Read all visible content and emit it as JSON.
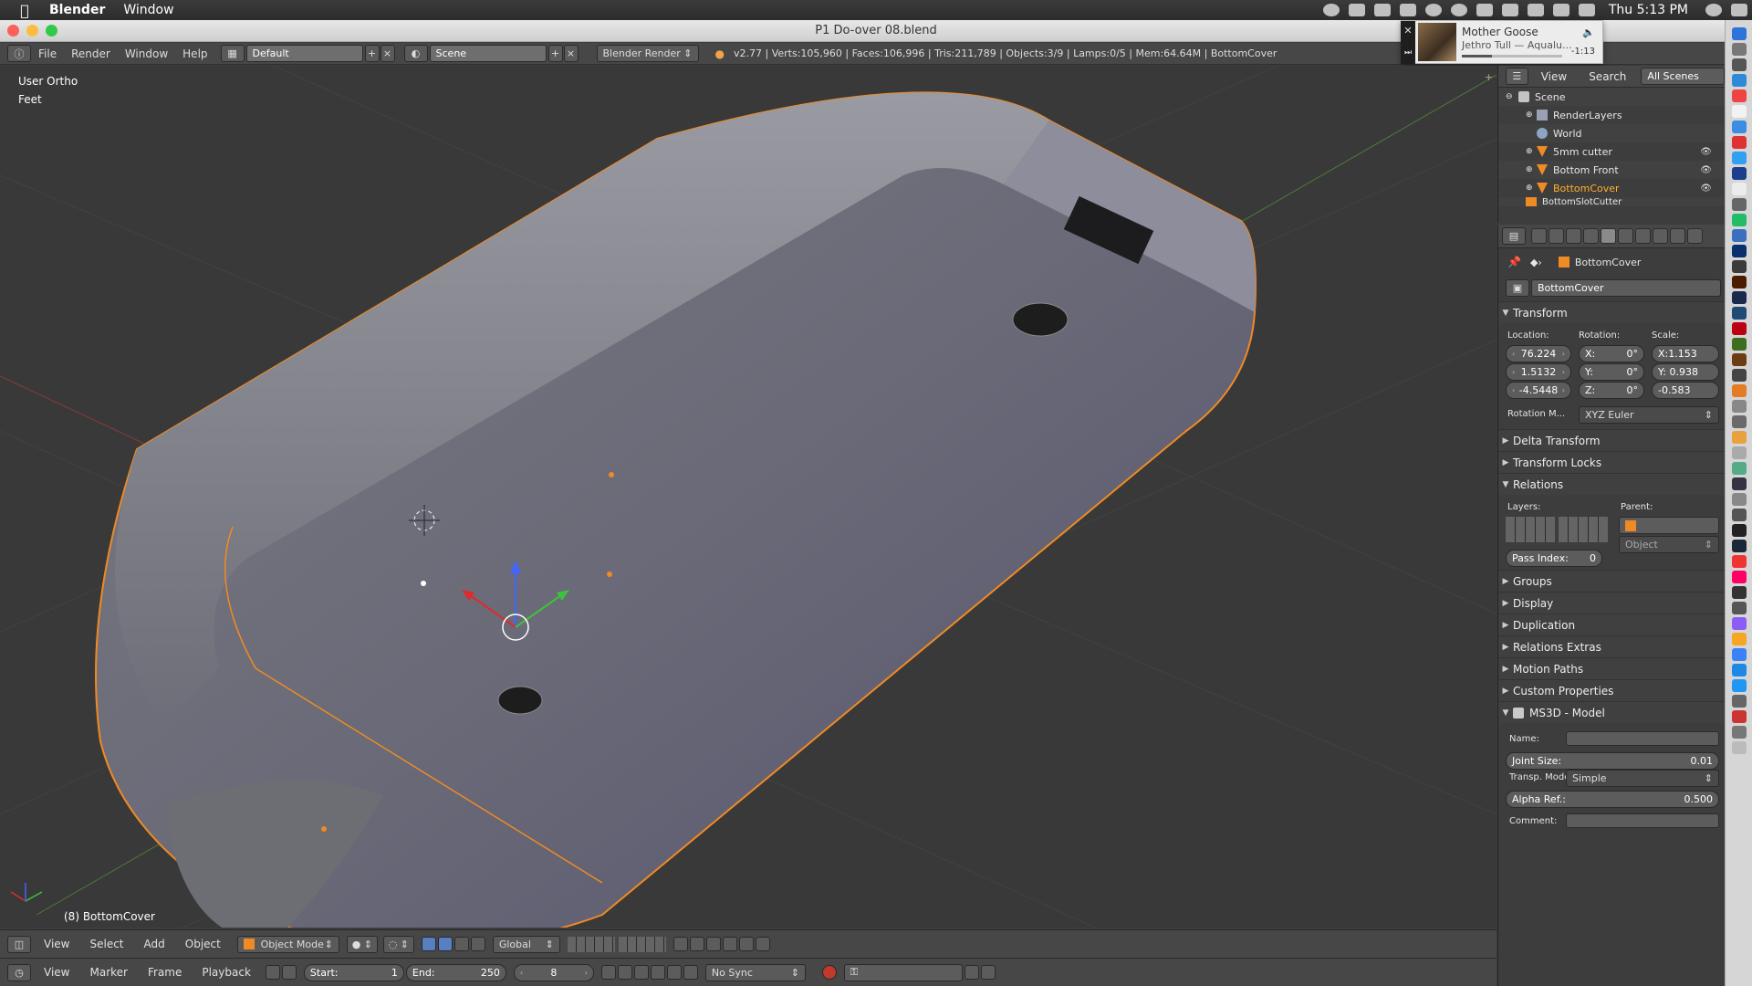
{
  "macmenu": {
    "app": "Blender",
    "items": [
      "Window"
    ],
    "clock": "Thu 5:13 PM"
  },
  "window": {
    "title": "P1 Do-over 08.blend"
  },
  "notification": {
    "title": "Mother Goose",
    "subtitle": "Jethro Tull — Aqualu...",
    "time": "-1:13"
  },
  "info": {
    "menus": [
      "File",
      "Render",
      "Window",
      "Help"
    ],
    "layout": "Default",
    "scene": "Scene",
    "engine": "Blender Render",
    "stats": "v2.77 | Verts:105,960 | Faces:106,996 | Tris:211,789 | Objects:3/9 | Lamps:0/5 | Mem:64.64M | BottomCover"
  },
  "viewport": {
    "view_name": "User Ortho",
    "units": "Feet",
    "object_label": "(8) BottomCover"
  },
  "outliner": {
    "tabs": [
      "View",
      "Search",
      "All Scenes"
    ],
    "rows": [
      "Scene",
      "RenderLayers",
      "World",
      "5mm cutter",
      "Bottom Front",
      "BottomCover",
      "BottomSlotCutter"
    ]
  },
  "properties": {
    "object_breadcrumb": "BottomCover",
    "object_name": "BottomCover",
    "transform": {
      "header": "Transform",
      "location_label": "Location:",
      "rotation_label": "Rotation:",
      "scale_label": "Scale:",
      "location": [
        "76.224",
        "1.5132",
        "-4.5448"
      ],
      "rotation": [
        {
          "axis": "X:",
          "value": "0°"
        },
        {
          "axis": "Y:",
          "value": "0°"
        },
        {
          "axis": "Z:",
          "value": "0°"
        }
      ],
      "scale": [
        "X:1.153",
        "Y: 0.938",
        "-0.583"
      ],
      "rotation_mode_label": "Rotation M...",
      "rotation_mode": "XYZ Euler"
    },
    "collapsed_panels_a": [
      "Delta Transform",
      "Transform Locks"
    ],
    "relations": {
      "header": "Relations",
      "layers_label": "Layers:",
      "parent_label": "Parent:",
      "parent_type": "Object",
      "pass_index_label": "Pass Index:",
      "pass_index": "0"
    },
    "collapsed_panels_b": [
      "Groups",
      "Display",
      "Duplication",
      "Relations Extras",
      "Motion Paths",
      "Custom Properties"
    ],
    "ms3d": {
      "header": "MS3D - Model",
      "name_label": "Name:",
      "joint_label": "Joint Size:",
      "joint_value": "0.01",
      "transp_label": "Transp. Mode:",
      "transp_value": "Simple",
      "alpha_label": "Alpha Ref.:",
      "alpha_value": "0.500",
      "comment_label": "Comment:"
    }
  },
  "view3d_header": {
    "menus": [
      "View",
      "Select",
      "Add",
      "Object"
    ],
    "mode": "Object Mode",
    "orientation": "Global"
  },
  "timeline": {
    "menus": [
      "View",
      "Marker",
      "Frame",
      "Playback"
    ],
    "start_label": "Start:",
    "start": "1",
    "end_label": "End:",
    "end": "250",
    "current": "8",
    "sync": "No Sync"
  },
  "colors": {
    "accent": "#5680c2",
    "selection": "#f08a24",
    "viewport_bg": "#393939"
  }
}
